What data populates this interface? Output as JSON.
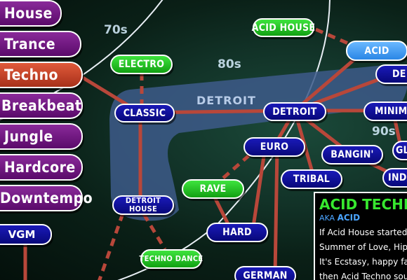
{
  "genres": [
    {
      "label": "House",
      "active": false
    },
    {
      "label": "Trance",
      "active": false
    },
    {
      "label": "Techno",
      "active": true
    },
    {
      "label": "Breakbeat",
      "active": false
    },
    {
      "label": "Jungle",
      "active": false
    },
    {
      "label": "Hardcore",
      "active": false
    },
    {
      "label": "Downtempo",
      "active": false
    }
  ],
  "extra_genre": "VGM",
  "eras": [
    "70s",
    "80s",
    "90s"
  ],
  "region_label": "DETROIT",
  "nodes": {
    "acid_house": "ACID HOUSE",
    "acid": "ACID",
    "electro": "ELECTRO",
    "classic": "CLASSIC",
    "detroit": "DETROIT",
    "minimal": "MINIMA",
    "deep": "DE",
    "euro": "EURO",
    "bangin": "BANGIN'",
    "gl": "GL",
    "tribal": "TRIBAL",
    "industrial": "INDU",
    "rave": "RAVE",
    "detroit_house_1": "DETROIT",
    "detroit_house_2": "HOUSE",
    "hard": "HARD",
    "techno_dance": "TECHNO DANCE",
    "german": "GERMAN"
  },
  "info": {
    "title": "ACID TECHNO",
    "aka_prefix": "AKA",
    "aka": "ACID",
    "lines": [
      "If Acid House started t",
      "Summer of Love, Hipp",
      "It's Ecstasy, happy fac",
      "then Acid Techno sou"
    ]
  },
  "colors": {
    "line": "#b8473a",
    "node_blue": "#10109a",
    "node_green": "#22c822",
    "node_selected": "#4aa4ff",
    "genre_purple": "#6a1a7a",
    "genre_active": "#c8462a",
    "region": "#3d5a8a"
  }
}
